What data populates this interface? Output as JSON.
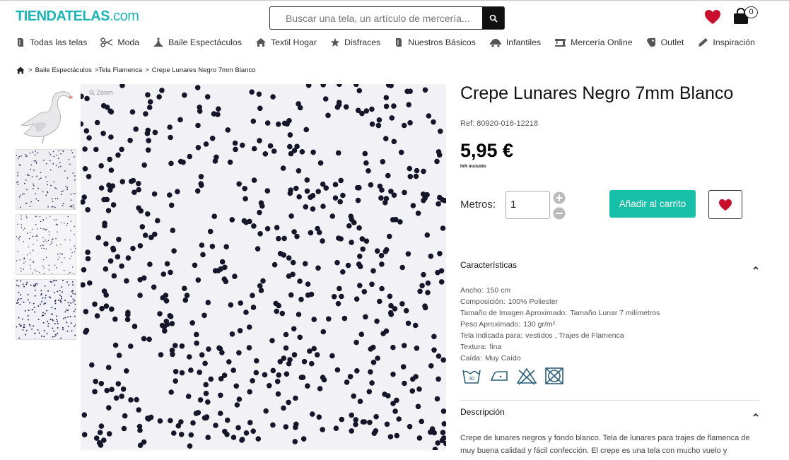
{
  "header": {
    "logo_main": "TIENDATELAS",
    "logo_suffix": ".com",
    "search_placeholder": "Buscar una tela, un artículo de mercería...",
    "cart_count": "0"
  },
  "nav": {
    "items": [
      {
        "label": "Todas las telas",
        "icon": "fabric-roll-icon"
      },
      {
        "label": "Moda",
        "icon": "scissors-icon"
      },
      {
        "label": "Baile Espectáculos",
        "icon": "dancer-icon"
      },
      {
        "label": "Textil Hogar",
        "icon": "home-icon"
      },
      {
        "label": "Disfraces",
        "icon": "star-icon"
      },
      {
        "label": "Nuestros Básicos",
        "icon": "fabric-roll-icon"
      },
      {
        "label": "Infantiles",
        "icon": "baby-car-icon"
      },
      {
        "label": "Mercería Online",
        "icon": "sewing-machine-icon"
      },
      {
        "label": "Outlet",
        "icon": "tag-icon"
      },
      {
        "label": "Inspiración",
        "icon": "pencil-icon"
      }
    ]
  },
  "breadcrumb": {
    "items": [
      "Baile Espectáculos",
      ">Tela Flamenca",
      "Crepe Lunares Negro 7mm Blanco"
    ]
  },
  "gallery": {
    "zoom_label": "Zoom"
  },
  "product": {
    "title": "Crepe Lunares Negro 7mm Blanco",
    "ref": "Ref: 80920-016-12218",
    "price": "5,95 €",
    "tax_note": "IVA incluido",
    "quantity_label": "Metros:",
    "quantity_value": "1",
    "add_to_cart_label": "Añadir al carrito"
  },
  "characteristics": {
    "heading": "Características",
    "rows": [
      {
        "label": "Ancho:",
        "value": "150 cm"
      },
      {
        "label": "Composición:",
        "value": "100% Poliester"
      },
      {
        "label": "Tamaño de Imagen Aproximado:",
        "value": "Tamaño Lunar 7 milímetros"
      },
      {
        "label": "Peso Aproximado:",
        "value": "130 gr/m²"
      },
      {
        "label": "Tela indicada para:",
        "value": "vestidos , Trajes de Flamenca"
      },
      {
        "label": "Textura:",
        "value": "fina"
      },
      {
        "label": "Caída:",
        "value": "Muy Caído"
      }
    ],
    "care_icons": [
      "wash-30-icon",
      "iron-low-icon",
      "no-bleach-icon",
      "no-tumble-dry-icon"
    ],
    "wash_temp": "30"
  },
  "description": {
    "heading": "Descripción",
    "text": "Crepe de lunares negros y fondo blanco. Tela de lunares para trajes de flamenca de muy buena calidad y fácil confección. El crepe es una tela con mucho vuelo y"
  },
  "colors": {
    "brand": "#1bb5b5",
    "accent_button": "#16bfa8",
    "heart": "#c8102e"
  }
}
